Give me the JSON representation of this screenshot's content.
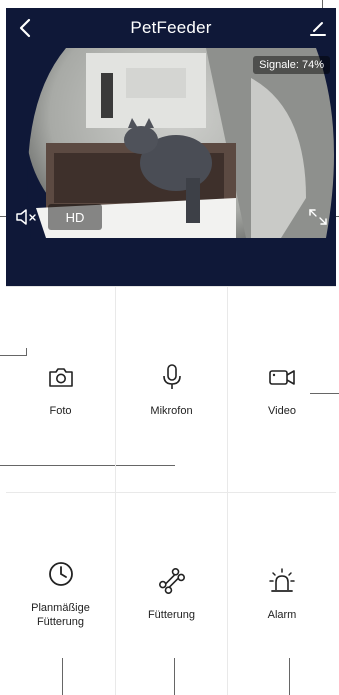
{
  "header": {
    "title": "PetFeeder",
    "back_icon": "chevron-left-icon",
    "edit_icon": "pencil-icon"
  },
  "video": {
    "signal_label": "Signale: 74%",
    "quality_label": "HD",
    "mute_icon": "speaker-muted-icon",
    "fullscreen_icon": "expand-icon"
  },
  "controls": [
    {
      "label": "Foto",
      "icon": "camera-icon"
    },
    {
      "label": "Mikrofon",
      "icon": "microphone-icon"
    },
    {
      "label": "Video",
      "icon": "video-camera-icon"
    },
    {
      "label": "Planmäßige Fütterung",
      "icon": "clock-icon"
    },
    {
      "label": "Fütterung",
      "icon": "bone-icon"
    },
    {
      "label": "Alarm",
      "icon": "siren-icon"
    }
  ],
  "colors": {
    "header_bg": "#0f1838",
    "text": "#222222"
  }
}
